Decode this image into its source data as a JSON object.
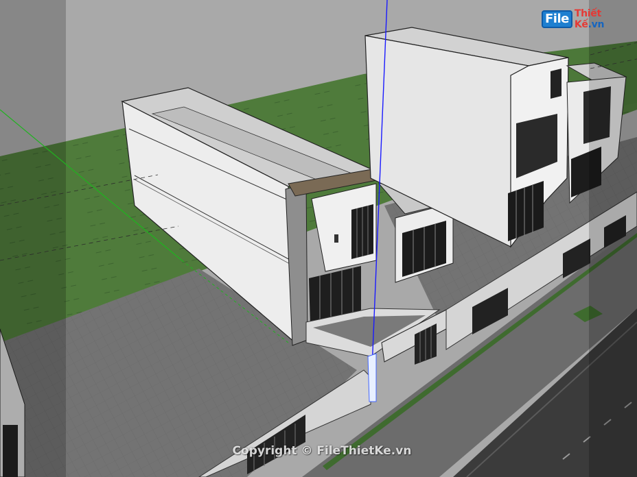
{
  "viewport": {
    "title": "SketchUp 3D model viewport"
  },
  "watermark": {
    "logo_file": "File",
    "logo_thiet": "Thiết ",
    "logo_ke": "Kế",
    "logo_domain": ".vn",
    "copyright": "Copyright © FileThietKe.vn"
  },
  "colors": {
    "sky": "#a9a9a9",
    "grass": "#4d7a3a",
    "pavement": "#6f6f6f",
    "road": "#3a3a3a",
    "wall": "#e9e9e9",
    "window": "#1b1b1b",
    "blue_axis": "#1a1aff",
    "green_axis": "#1fb31f",
    "overlay": "rgba(0,0,0,0.22)"
  }
}
